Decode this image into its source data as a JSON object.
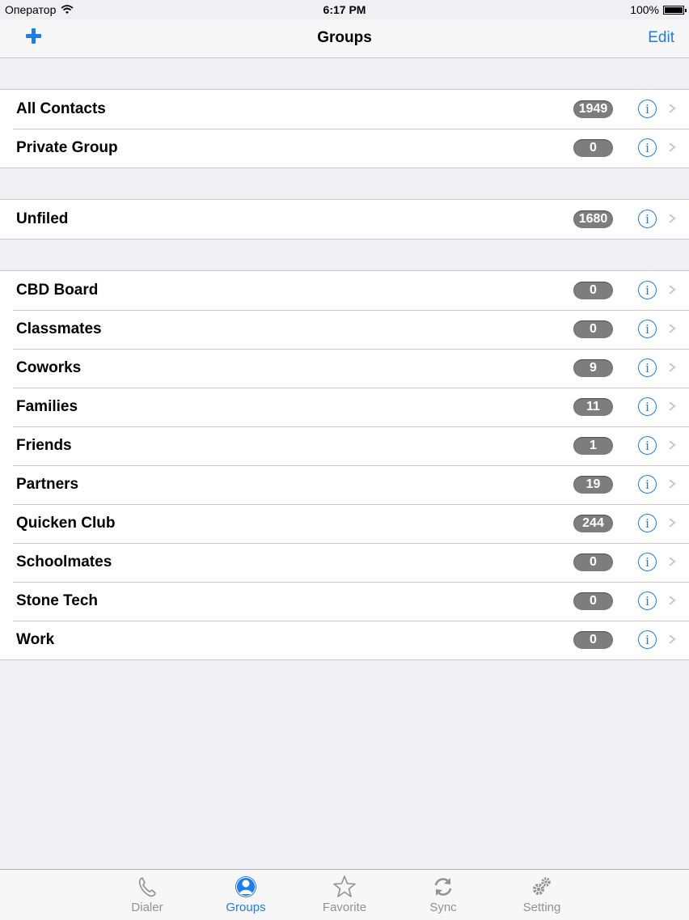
{
  "status_bar": {
    "carrier": "Оператор",
    "time": "6:17 PM",
    "battery": "100%"
  },
  "nav": {
    "title": "Groups",
    "edit_label": "Edit"
  },
  "sections": [
    [
      {
        "label": "All Contacts",
        "count": "1949"
      },
      {
        "label": "Private Group",
        "count": "0"
      }
    ],
    [
      {
        "label": "Unfiled",
        "count": "1680"
      }
    ],
    [
      {
        "label": "CBD Board",
        "count": "0"
      },
      {
        "label": "Classmates",
        "count": "0"
      },
      {
        "label": "Coworks",
        "count": "9"
      },
      {
        "label": "Families",
        "count": "11"
      },
      {
        "label": "Friends",
        "count": "1"
      },
      {
        "label": "Partners",
        "count": "19"
      },
      {
        "label": "Quicken Club",
        "count": "244"
      },
      {
        "label": "Schoolmates",
        "count": "0"
      },
      {
        "label": "Stone Tech",
        "count": "0"
      },
      {
        "label": "Work",
        "count": "0"
      }
    ]
  ],
  "tabs": [
    {
      "label": "Dialer",
      "icon": "phone-icon",
      "active": false
    },
    {
      "label": "Groups",
      "icon": "person-circle-icon",
      "active": true
    },
    {
      "label": "Favorite",
      "icon": "star-icon",
      "active": false
    },
    {
      "label": "Sync",
      "icon": "sync-icon",
      "active": false
    },
    {
      "label": "Setting",
      "icon": "gears-icon",
      "active": false
    }
  ],
  "colors": {
    "accent": "#1e7cf2",
    "badge": "#7d7d7d",
    "background": "#efeff4"
  }
}
